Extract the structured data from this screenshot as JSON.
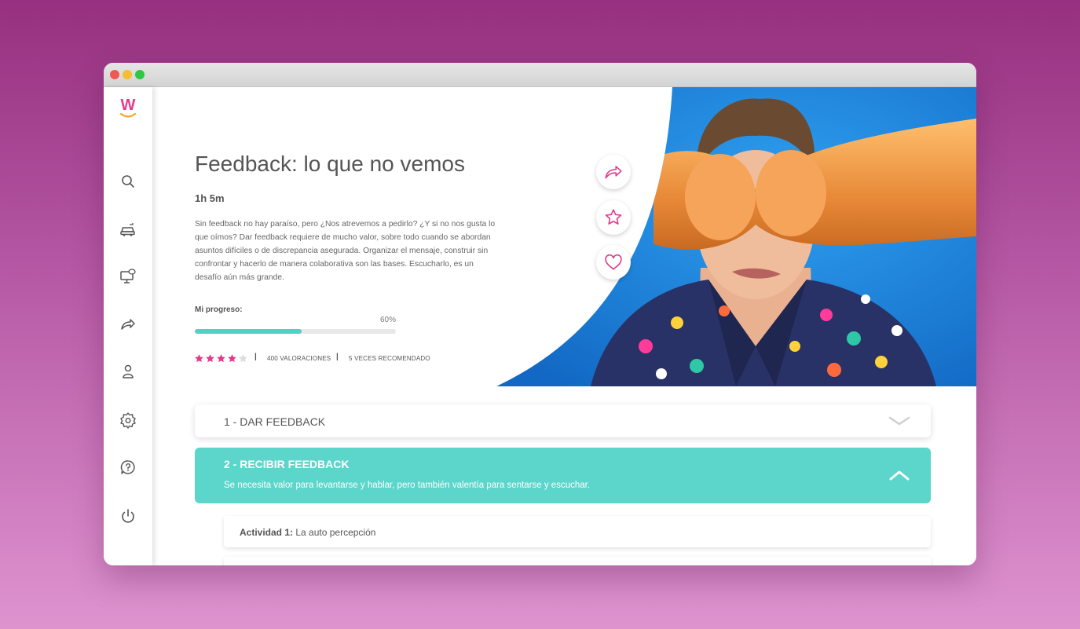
{
  "course": {
    "title": "Feedback: lo que no vemos",
    "duration": "1h 5m",
    "description": "Sin feedback no hay paraíso, pero ¿Nos atrevemos a pedirlo? ¿Y si no nos gusta lo que oímos? Dar feedback requiere de mucho valor, sobre todo cuando se abordan asuntos difíciles o de discrepancia asegurada. Organizar el mensaje, construir sin confrontar y hacerlo de manera colaborativa son las bases. Escucharlo, es un desafío aún más grande.",
    "progress_label": "Mi progreso:",
    "progress_value_text": "60%",
    "progress_fraction": 0.53,
    "rating_stars": 4,
    "rating_max": 5,
    "ratings_text": "400 VALORACIONES",
    "recommended_text": "5 VECES RECOMENDADO",
    "separator": "|"
  },
  "logo": {
    "letter": "W"
  },
  "sidebar": {
    "items": [
      {
        "icon": "search-icon"
      },
      {
        "icon": "car-icon"
      },
      {
        "icon": "monitor-chat-icon"
      },
      {
        "icon": "share-icon"
      },
      {
        "icon": "user-icon"
      },
      {
        "icon": "gear-icon"
      },
      {
        "icon": "help-icon"
      },
      {
        "icon": "power-icon"
      }
    ]
  },
  "actions": [
    {
      "icon": "share-icon"
    },
    {
      "icon": "star-icon"
    },
    {
      "icon": "heart-icon"
    }
  ],
  "sections": [
    {
      "label": "1 - DAR FEEDBACK",
      "expanded": false
    },
    {
      "label": "2 - RECIBIR FEEDBACK",
      "subtitle": "Se necesita valor para levantarse y hablar, pero también valentía para sentarse y escuchar.",
      "expanded": true
    }
  ],
  "activities": [
    {
      "prefix": "Actividad 1:",
      "label": "La auto percepción"
    },
    {
      "prefix": "",
      "label": ""
    }
  ],
  "colors": {
    "brand": "#e23c8c",
    "accent": "#5cd5cb",
    "progress": "#4fd1c4",
    "hero_bg": "#1c83dc",
    "star_on": "#e23c8c",
    "star_off": "#dddddd"
  }
}
